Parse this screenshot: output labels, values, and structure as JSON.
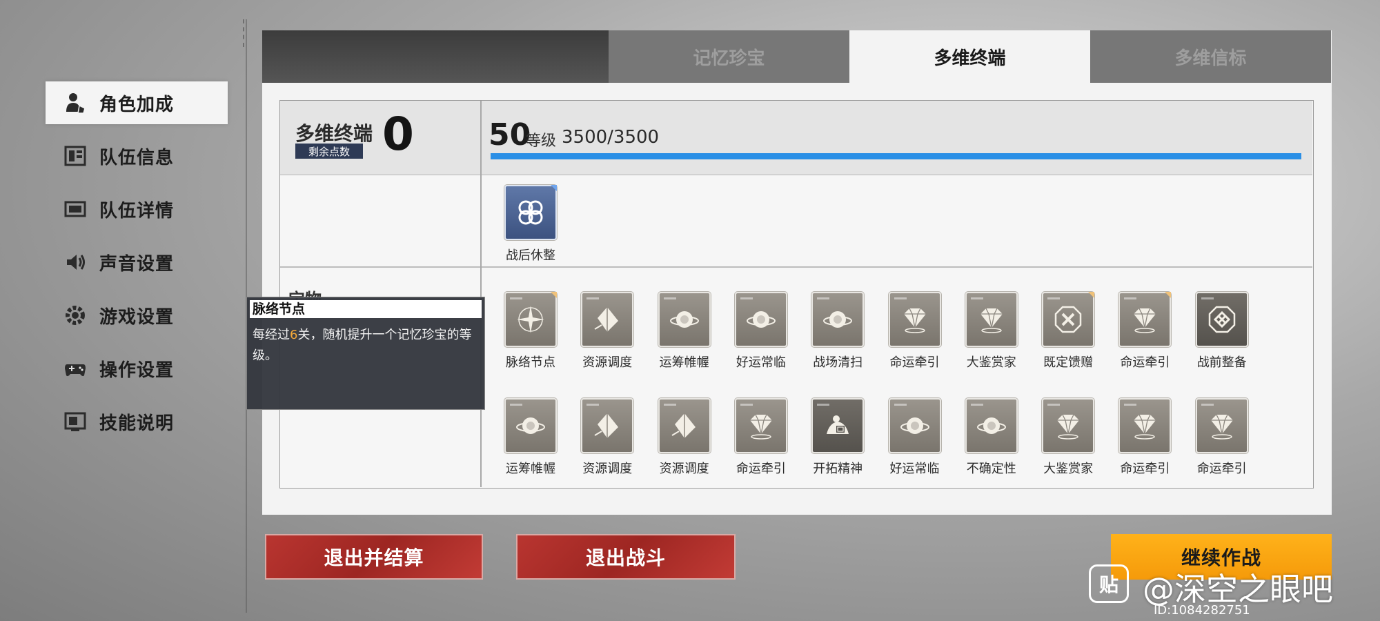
{
  "sidebar": {
    "items": [
      {
        "label": "角色加成",
        "icon": "character-icon"
      },
      {
        "label": "队伍信息",
        "icon": "team-info-icon"
      },
      {
        "label": "队伍详情",
        "icon": "team-detail-icon"
      },
      {
        "label": "声音设置",
        "icon": "speaker-icon"
      },
      {
        "label": "游戏设置",
        "icon": "gear-icon"
      },
      {
        "label": "操作设置",
        "icon": "gamepad-icon"
      },
      {
        "label": "技能说明",
        "icon": "skill-monitor-icon"
      }
    ]
  },
  "tabs": [
    {
      "label": "记忆珍宝",
      "active": false
    },
    {
      "label": "多维终端",
      "active": true
    },
    {
      "label": "多维信标",
      "active": false
    }
  ],
  "terminal": {
    "title": "多维终端",
    "points_label": "剩余点数",
    "points_value": "0",
    "level": "50",
    "level_label": "等级",
    "exp": "3500/3500",
    "progress": 1.0
  },
  "blessing": {
    "label": "战后休整",
    "icon": "knot-icon"
  },
  "treasure_section_label": "宝物",
  "treasures_row1": [
    {
      "label": "脉络节点",
      "icon": "compass-star-icon"
    },
    {
      "label": "资源调度",
      "icon": "diamond-shard-icon"
    },
    {
      "label": "运筹帷幄",
      "icon": "planet-icon"
    },
    {
      "label": "好运常临",
      "icon": "planet-icon"
    },
    {
      "label": "战场清扫",
      "icon": "planet-icon"
    },
    {
      "label": "命运牵引",
      "icon": "gem-icon"
    },
    {
      "label": "大鉴赏家",
      "icon": "gem-icon"
    },
    {
      "label": "既定馈赠",
      "icon": "octagon-cross-icon"
    },
    {
      "label": "命运牵引",
      "icon": "gem-icon"
    },
    {
      "label": "战前整备",
      "icon": "octagon-knot-icon"
    }
  ],
  "treasures_row2": [
    {
      "label": "运筹帷幄",
      "icon": "planet-icon"
    },
    {
      "label": "资源调度",
      "icon": "diamond-shard-icon"
    },
    {
      "label": "资源调度",
      "icon": "diamond-shard-icon"
    },
    {
      "label": "命运牵引",
      "icon": "gem-icon"
    },
    {
      "label": "开拓精神",
      "icon": "pioneer-figure-icon"
    },
    {
      "label": "好运常临",
      "icon": "planet-icon"
    },
    {
      "label": "不确定性",
      "icon": "planet-icon"
    },
    {
      "label": "大鉴赏家",
      "icon": "gem-icon"
    },
    {
      "label": "命运牵引",
      "icon": "gem-icon"
    },
    {
      "label": "命运牵引",
      "icon": "gem-icon"
    }
  ],
  "tooltip": {
    "title": "脉络节点",
    "text_before": "每经过",
    "highlight": "6",
    "text_after": "关，随机提升一个记忆珍宝的等级。"
  },
  "buttons": {
    "exit_settle": "退出并结算",
    "exit_battle": "退出战斗",
    "continue": "继续作战"
  },
  "watermark": {
    "logo_char": "贴",
    "text": "@深空之眼吧",
    "id": "ID:1084282751"
  },
  "colors": {
    "accent_blue": "#2a8fe6",
    "exit_red": "#a82b27",
    "continue_yellow": "#ffab14",
    "highlight_orange": "#f3a83a"
  }
}
